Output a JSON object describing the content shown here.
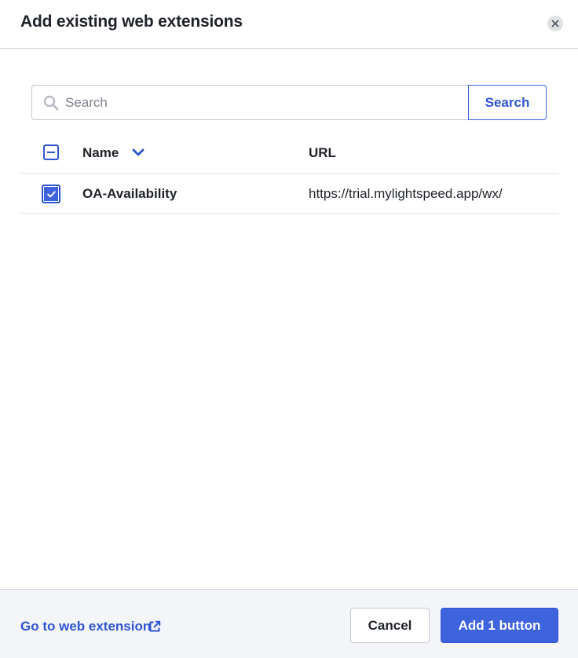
{
  "dialog": {
    "title": "Add existing web extensions"
  },
  "search": {
    "placeholder": "Search",
    "value": "",
    "button_label": "Search"
  },
  "table": {
    "columns": {
      "name": "Name",
      "url": "URL"
    },
    "rows": [
      {
        "name": "OA-Availability",
        "url": "https://trial.mylightspeed.app/wx/",
        "checked": true
      }
    ]
  },
  "footer": {
    "link_label": "Go to web extension",
    "cancel_label": "Cancel",
    "add_label": "Add 1 button"
  },
  "icons": {
    "close": "close-icon",
    "search": "search-icon",
    "sort": "chevron-down-icon",
    "checkmark": "checkmark-icon",
    "external": "external-link-icon"
  },
  "colors": {
    "accent": "#3d63dd",
    "link": "#2f55d4",
    "footer_bg": "#f4f5f8"
  }
}
